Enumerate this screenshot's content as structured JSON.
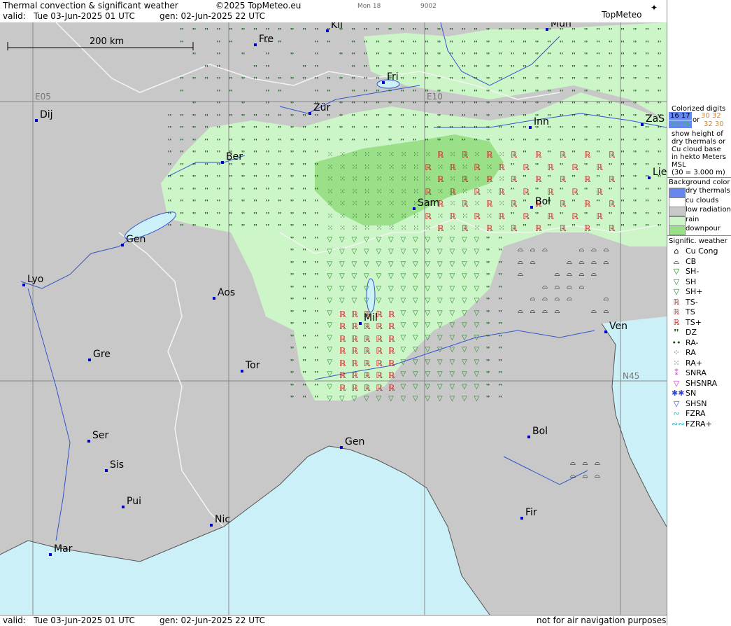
{
  "header": {
    "title": "Thermal convection & significant weather",
    "copyright": "©2025 TopMeteo.eu",
    "valid_label": "valid:",
    "valid_value": "Tue  03-Jun-2025  01 UTC",
    "gen_label": "gen: 02-Jun-2025 22 UTC",
    "day_small": "Mon 18",
    "code_small": "9002",
    "logo": "TopMeteo"
  },
  "footer": {
    "valid_label": "valid:",
    "valid_value": "Tue  03-Jun-2025  01 UTC",
    "gen_label": "gen: 02-Jun-2025 22 UTC",
    "disclaimer": "not for air navigation purposes"
  },
  "scale": {
    "label": "200 km"
  },
  "grid_labels": {
    "e05": "E05",
    "e10": "E10",
    "n45": "N45"
  },
  "cities": [
    {
      "id": "kli",
      "label": "Kli"
    },
    {
      "id": "mun",
      "label": "Mun"
    },
    {
      "id": "fre",
      "label": "Fre"
    },
    {
      "id": "fri",
      "label": "Fri"
    },
    {
      "id": "dij",
      "label": "Dij"
    },
    {
      "id": "zur",
      "label": "Zür"
    },
    {
      "id": "inn",
      "label": "Inn"
    },
    {
      "id": "zas",
      "label": "ZaS"
    },
    {
      "id": "ber",
      "label": "Ber"
    },
    {
      "id": "lie",
      "label": "Lie"
    },
    {
      "id": "sam",
      "label": "Sam"
    },
    {
      "id": "bol1",
      "label": "Bol"
    },
    {
      "id": "gen1",
      "label": "Gen"
    },
    {
      "id": "lyo",
      "label": "Lyo"
    },
    {
      "id": "aos",
      "label": "Aos"
    },
    {
      "id": "mil",
      "label": "Mil"
    },
    {
      "id": "ven",
      "label": "Ven"
    },
    {
      "id": "gre",
      "label": "Gre"
    },
    {
      "id": "tor",
      "label": "Tor"
    },
    {
      "id": "ser",
      "label": "Ser"
    },
    {
      "id": "gen2",
      "label": "Gen"
    },
    {
      "id": "bol2",
      "label": "Bol"
    },
    {
      "id": "sis",
      "label": "Sis"
    },
    {
      "id": "pui",
      "label": "Pui"
    },
    {
      "id": "nic",
      "label": "Nic"
    },
    {
      "id": "fir",
      "label": "Fir"
    },
    {
      "id": "mar",
      "label": "Mar"
    }
  ],
  "legend": {
    "colorized_title": "Colorized digits",
    "digits_a": "16 17",
    "digits_b": "25 26",
    "or": "or",
    "digits_c": "30 32",
    "digits_d": "32 30",
    "desc1": "show height of",
    "desc2": "dry thermals or",
    "desc3": "Cu cloud base",
    "desc4": "in hekto Meters",
    "desc5": "MSL",
    "desc6": "(30 = 3.000 m)",
    "bg_title": "Background color",
    "bg_items": [
      {
        "label": "dry thermals",
        "color": "#6688ee"
      },
      {
        "label": "cu clouds",
        "color": "#ffffff"
      },
      {
        "label": "low radiation",
        "color": "#c8c8c8"
      },
      {
        "label": "rain",
        "color": "#ccf5c8"
      },
      {
        "label": "downpour",
        "color": "#99e088"
      }
    ],
    "wx_title": "Signific. weather",
    "wx_items": [
      {
        "label": "Cu Cong",
        "sym": "⌂",
        "color": "#000000"
      },
      {
        "label": "CB",
        "sym": "⌓",
        "color": "#000000"
      },
      {
        "label": "SH-",
        "sym": "▽",
        "color": "#228822"
      },
      {
        "label": "SH",
        "sym": "▽",
        "color": "#228822"
      },
      {
        "label": "SH+",
        "sym": "▽",
        "color": "#228822"
      },
      {
        "label": "TS-",
        "sym": "ℝ",
        "color": "#bb2222"
      },
      {
        "label": "TS",
        "sym": "ℝ",
        "color": "#bb2222"
      },
      {
        "label": "TS+",
        "sym": "ℝ",
        "color": "#bb2222"
      },
      {
        "label": "DZ",
        "sym": "❜❜",
        "color": "#115511"
      },
      {
        "label": "RA-",
        "sym": "••",
        "color": "#115511"
      },
      {
        "label": "RA",
        "sym": "⁘",
        "color": "#115511"
      },
      {
        "label": "RA+",
        "sym": "⁙",
        "color": "#115511"
      },
      {
        "label": "SNRA",
        "sym": "⁑",
        "color": "#cc33cc"
      },
      {
        "label": "SHSNRA",
        "sym": "▽",
        "color": "#cc33cc"
      },
      {
        "label": "SN",
        "sym": "✱✱",
        "color": "#3344cc"
      },
      {
        "label": "SHSN",
        "sym": "▽",
        "color": "#3344cc"
      },
      {
        "label": "FZRA",
        "sym": "∾",
        "color": "#22bbcc"
      },
      {
        "label": "FZRA+",
        "sym": "∾∾",
        "color": "#22bbcc"
      }
    ]
  }
}
